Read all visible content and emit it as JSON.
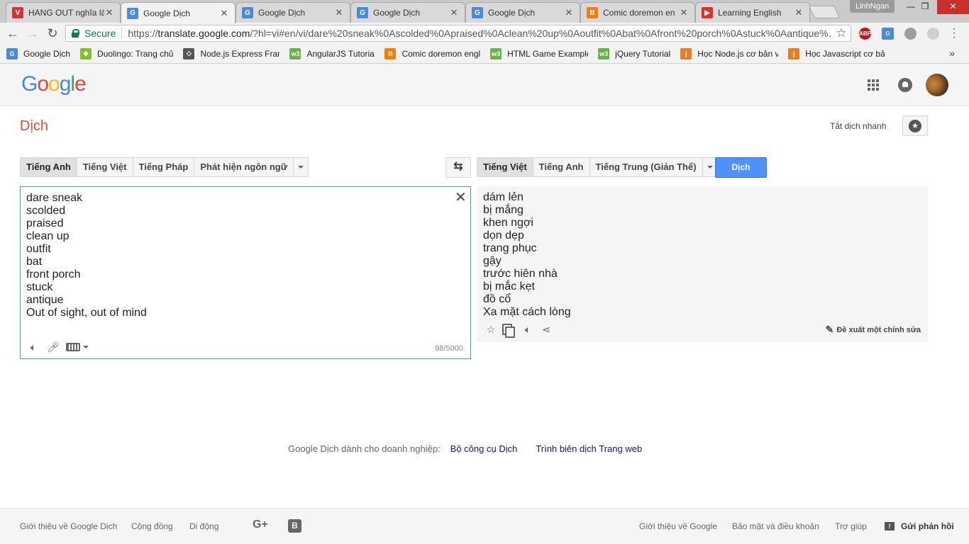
{
  "browser": {
    "tabs": [
      {
        "title": "HANG OUT nghĩa là",
        "icon": "vocab-icon",
        "color": "#d23535",
        "glyph": "V"
      },
      {
        "title": "Google Dịch",
        "icon": "google-translate-icon",
        "color": "#4a89dc",
        "glyph": "G"
      },
      {
        "title": "Google Dịch",
        "icon": "google-translate-icon",
        "color": "#4a89dc",
        "glyph": "G"
      },
      {
        "title": "Google Dịch",
        "icon": "google-translate-icon",
        "color": "#4a89dc",
        "glyph": "G"
      },
      {
        "title": "Google Dịch",
        "icon": "google-translate-icon",
        "color": "#4a89dc",
        "glyph": "G"
      },
      {
        "title": "Comic doremon en",
        "icon": "blogger-icon",
        "color": "#f57d00",
        "glyph": "B"
      },
      {
        "title": "Learning English",
        "icon": "youtube-icon",
        "color": "#e52d27",
        "glyph": "▶"
      }
    ],
    "profile_name": "LinhNgan",
    "window_controls": {
      "minimize": "—",
      "maximize": "❐",
      "close": "✕"
    },
    "nav": {
      "back": "←",
      "forward": "→",
      "reload": "↻"
    },
    "secure_label": "Secure",
    "url_scheme": "https://",
    "url_host": "translate.google.com",
    "url_path": "/?hl=vi#en/vi/dare%20sneak%0Ascolded%0Apraised%0Aclean%20up%0Aoutfit%0Abat%0Afront%20porch%0Astuck%0Aantique%…",
    "extensions": [
      {
        "name": "adblock-icon",
        "label": "ABP",
        "color": "#c4161c"
      },
      {
        "name": "google-translate-ext-icon",
        "label": "G",
        "color": "#4a89dc"
      },
      {
        "name": "extension-gray-icon",
        "label": "",
        "color": "#9e9e9e"
      },
      {
        "name": "extension-light-icon",
        "label": "",
        "color": "#cfcfcf"
      }
    ]
  },
  "bookmarks": [
    {
      "label": "Google Dịch",
      "icon": "google-translate-icon",
      "color": "#4a89dc",
      "glyph": "G",
      "width": 78
    },
    {
      "label": "Duolingo: Trang chủ",
      "icon": "duolingo-icon",
      "color": "#7cc220",
      "glyph": "◆",
      "width": 124
    },
    {
      "label": "Node.js Express Fram",
      "icon": "nodejs-icon",
      "color": "#555555",
      "glyph": "◇",
      "width": 112
    },
    {
      "label": "AngularJS Tutorial",
      "icon": "w3schools-icon",
      "color": "#6ab04c",
      "glyph": "w3",
      "width": 96
    },
    {
      "label": "Comic doremon engl",
      "icon": "blogger-icon",
      "color": "#f57d00",
      "glyph": "B",
      "width": 112
    },
    {
      "label": "HTML Game Example",
      "icon": "w3schools-icon",
      "color": "#6ab04c",
      "glyph": "w3",
      "width": 114
    },
    {
      "label": "jQuery Tutorial",
      "icon": "w3schools-icon",
      "color": "#6ab04c",
      "glyph": "w3",
      "width": 80
    },
    {
      "label": "Học Node.js cơ bản v",
      "icon": "j-icon",
      "color": "#e67e22",
      "glyph": "j",
      "width": 114
    },
    {
      "label": "Học Javascript cơ bản",
      "icon": "j-icon",
      "color": "#e67e22",
      "glyph": "j",
      "width": 112
    }
  ],
  "bookmarks_more": "»",
  "header": {
    "logo_letters": [
      {
        "ch": "G",
        "color": "#4285f4"
      },
      {
        "ch": "o",
        "color": "#ea4335"
      },
      {
        "ch": "o",
        "color": "#fbbc05"
      },
      {
        "ch": "g",
        "color": "#4285f4"
      },
      {
        "ch": "l",
        "color": "#34a853"
      },
      {
        "ch": "e",
        "color": "#ea4335"
      }
    ]
  },
  "subheader": {
    "title": "Dịch",
    "instant_translate": "Tắt dịch nhanh",
    "star_glyph": "★"
  },
  "source_langs": [
    "Tiếng Anh",
    "Tiếng Việt",
    "Tiếng Pháp",
    "Phát hiện ngôn ngữ"
  ],
  "target_langs": [
    "Tiếng Việt",
    "Tiếng Anh",
    "Tiếng Trung (Giản Thể)"
  ],
  "swap_glyph": "⇆",
  "translate_button": "Dịch",
  "source": {
    "text": "dare sneak\nscolded\npraised\nclean up\noutfit\nbat\nfront porch\nstuck\nantique\nOut of sight, out of mind",
    "clear_glyph": "✕",
    "char_count": "98/5000"
  },
  "result": {
    "text": "dám lẻn\nbị mắng\nkhen ngợi\ndọn dẹp\ntrang phục\ngậy\ntrước hiên nhà\nbị mắc kẹt\nđồ cổ\nXa mặt cách lòng",
    "suggest_edit": "Đề xuất một chỉnh sửa"
  },
  "business": {
    "prefix": "Google Dịch dành cho doanh nghiệp:",
    "link1": "Bộ công cụ Dịch",
    "link2": "Trình biên dịch Trang web"
  },
  "footer": {
    "about": "Giới thiệu về Google Dịch",
    "community": "Cộng đồng",
    "mobile": "Di động",
    "gplus": "G+",
    "blogger": "B",
    "about_google": "Giới thiệu về Google",
    "privacy": "Bảo mật và điều khoản",
    "help": "Trợ giúp",
    "feedback": "Gửi phản hồi"
  }
}
